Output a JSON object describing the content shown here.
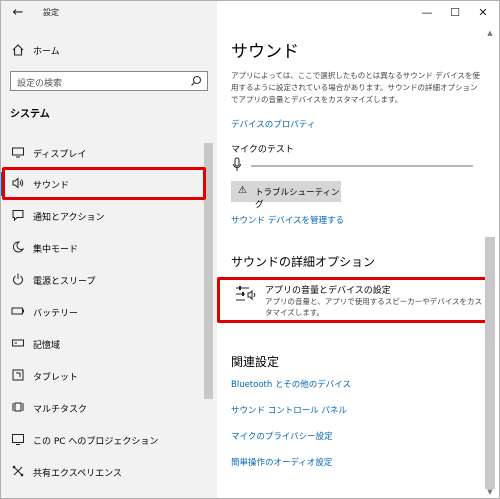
{
  "window": {
    "title": "設定",
    "back_icon": "←",
    "controls": {
      "minimize": "—",
      "maximize": "☐",
      "close": "✕"
    }
  },
  "sidebar": {
    "home_label": "ホーム",
    "search_placeholder": "設定の検索",
    "section_label": "システム",
    "items": [
      {
        "label": "ディスプレイ",
        "icon": "display-icon"
      },
      {
        "label": "サウンド",
        "icon": "speaker-icon",
        "selected": true
      },
      {
        "label": "通知とアクション",
        "icon": "notification-icon"
      },
      {
        "label": "集中モード",
        "icon": "moon-icon"
      },
      {
        "label": "電源とスリープ",
        "icon": "power-icon"
      },
      {
        "label": "バッテリー",
        "icon": "battery-icon"
      },
      {
        "label": "記憶域",
        "icon": "storage-icon"
      },
      {
        "label": "タブレット",
        "icon": "tablet-icon"
      },
      {
        "label": "マルチタスク",
        "icon": "multitask-icon"
      },
      {
        "label": "この PC へのプロジェクション",
        "icon": "projection-icon"
      },
      {
        "label": "共有エクスペリエンス",
        "icon": "shared-icon"
      }
    ]
  },
  "main": {
    "title": "サウンド",
    "description": "アプリによっては、ここで選択したものとは異なるサウンド デバイスを使用するように設定されている場合があります。サウンドの詳細オプションでアプリの音量とデバイスをカスタマイズします。",
    "device_properties_link": "デバイスのプロパティ",
    "mic_test_label": "マイクのテスト",
    "troubleshoot_button": "トラブルシューティング",
    "manage_devices_link": "サウンド デバイスを管理する",
    "advanced_title": "サウンドの詳細オプション",
    "advanced_item_title": "アプリの音量とデバイスの設定",
    "advanced_item_desc": "アプリの音量と、アプリで使用するスピーカーやデバイスをカスタマイズします。",
    "related_title": "関連設定",
    "related_links": [
      "Bluetooth とその他のデバイス",
      "サウンド コントロール パネル",
      "マイクのプライバシー設定",
      "簡単操作のオーディオ設定"
    ]
  },
  "colors": {
    "accent": "#0063b1",
    "link": "#0066b4",
    "highlight": "#e00000",
    "sidebar_bg": "#f2f2f2"
  }
}
